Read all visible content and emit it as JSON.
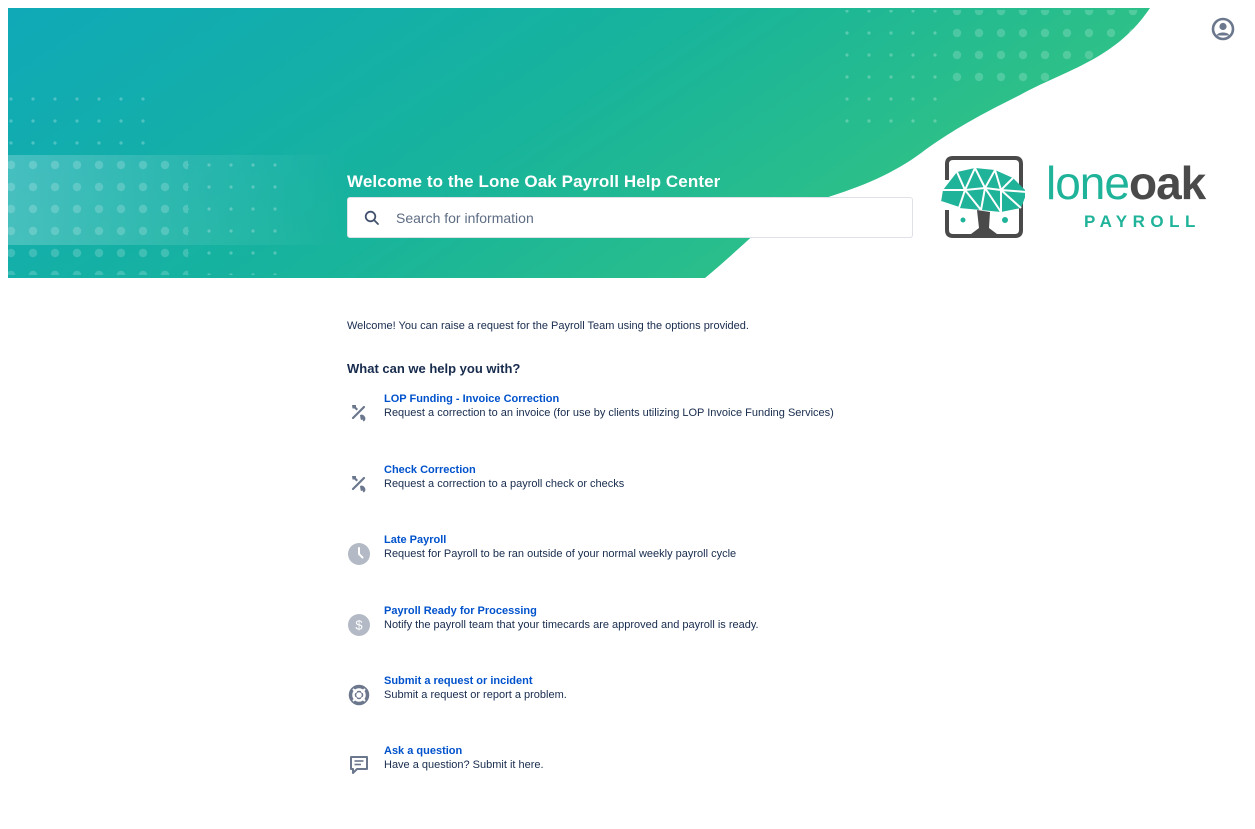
{
  "header": {
    "title": "Welcome to the Lone Oak Payroll Help Center",
    "search_placeholder": "Search for information",
    "logo": {
      "word_part1": "lone",
      "word_part2": "oak",
      "subtitle": "PAYROLL"
    },
    "profile_icon": "user-circle-icon"
  },
  "colors": {
    "banner_start": "#11a9b5",
    "banner_end": "#2dc08a",
    "logo_green": "#1fb39a",
    "link_blue": "#0052cc",
    "icon_gray": "#6b778c"
  },
  "main": {
    "intro": "Welcome! You can raise a request for the Payroll Team using the options provided.",
    "heading": "What can we help you with?",
    "options": [
      {
        "title": "LOP Funding - Invoice Correction",
        "description": "Request a correction to an invoice (for use by clients utilizing LOP Invoice Funding Services)",
        "icon": "tools-icon"
      },
      {
        "title": "Check Correction",
        "description": "Request a correction to a payroll check or checks",
        "icon": "tools-icon"
      },
      {
        "title": "Late Payroll",
        "description": "Request for Payroll to be ran outside of your normal weekly payroll cycle",
        "icon": "clock-icon"
      },
      {
        "title": "Payroll Ready for Processing",
        "description": "Notify the payroll team that your timecards are approved and payroll is ready.",
        "icon": "dollar-icon"
      },
      {
        "title": "Submit a request or incident",
        "description": "Submit a request or report a problem.",
        "icon": "lifebuoy-icon"
      },
      {
        "title": "Ask a question",
        "description": "Have a question? Submit it here.",
        "icon": "chat-icon"
      }
    ]
  }
}
